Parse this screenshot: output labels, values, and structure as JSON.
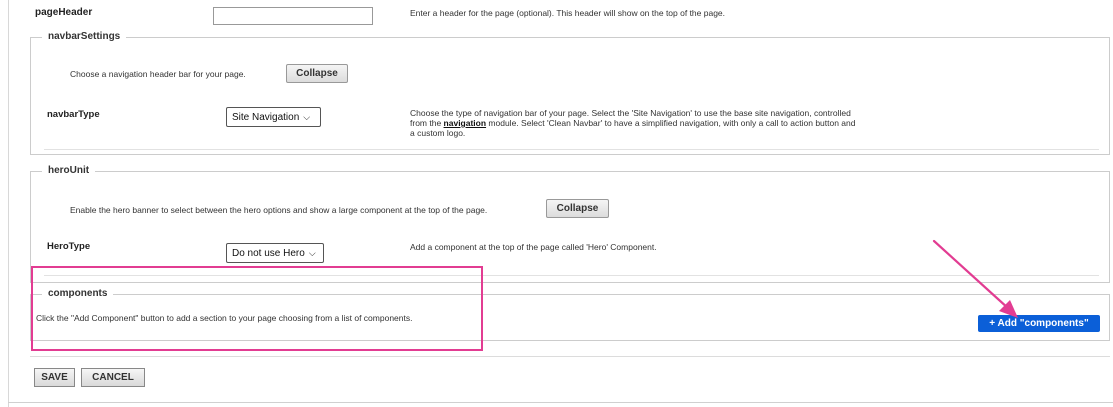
{
  "page_header": {
    "label": "pageHeader",
    "value": "",
    "description": "Enter a header for the page (optional). This header will show on the top of the page."
  },
  "navbar_settings": {
    "legend": "navbarSettings",
    "intro": "Choose a navigation header bar for your page.",
    "collapse_label": "Collapse",
    "type_label": "navbarType",
    "type_value": "Site Navigation",
    "desc_part1": "Choose the type of navigation bar of your page. Select the 'Site Navigation' to use the base site navigation, controlled",
    "desc_part2_prefix": "from the ",
    "desc_link": "navigation",
    "desc_part2_suffix": " module. Select 'Clean Navbar' to have a simplified navigation, with only a call to action button and",
    "desc_part3": "a custom logo."
  },
  "hero_unit": {
    "legend": "heroUnit",
    "intro": "Enable the hero banner to select between the hero options and show a large component at the top of the page.",
    "collapse_label": "Collapse",
    "type_label": "HeroType",
    "type_value": "Do not use Hero",
    "description": "Add a component at the top of the page called 'Hero' Component."
  },
  "components": {
    "legend": "components",
    "description": "Click the \"Add Component\" button to add a section to your page choosing from a list of components.",
    "add_button_label": "+ Add \"components\""
  },
  "form_actions": {
    "save_label": "SAVE",
    "cancel_label": "CANCEL"
  },
  "colors": {
    "annotation": "#e23c92",
    "primary_button": "#0b5fd8"
  }
}
